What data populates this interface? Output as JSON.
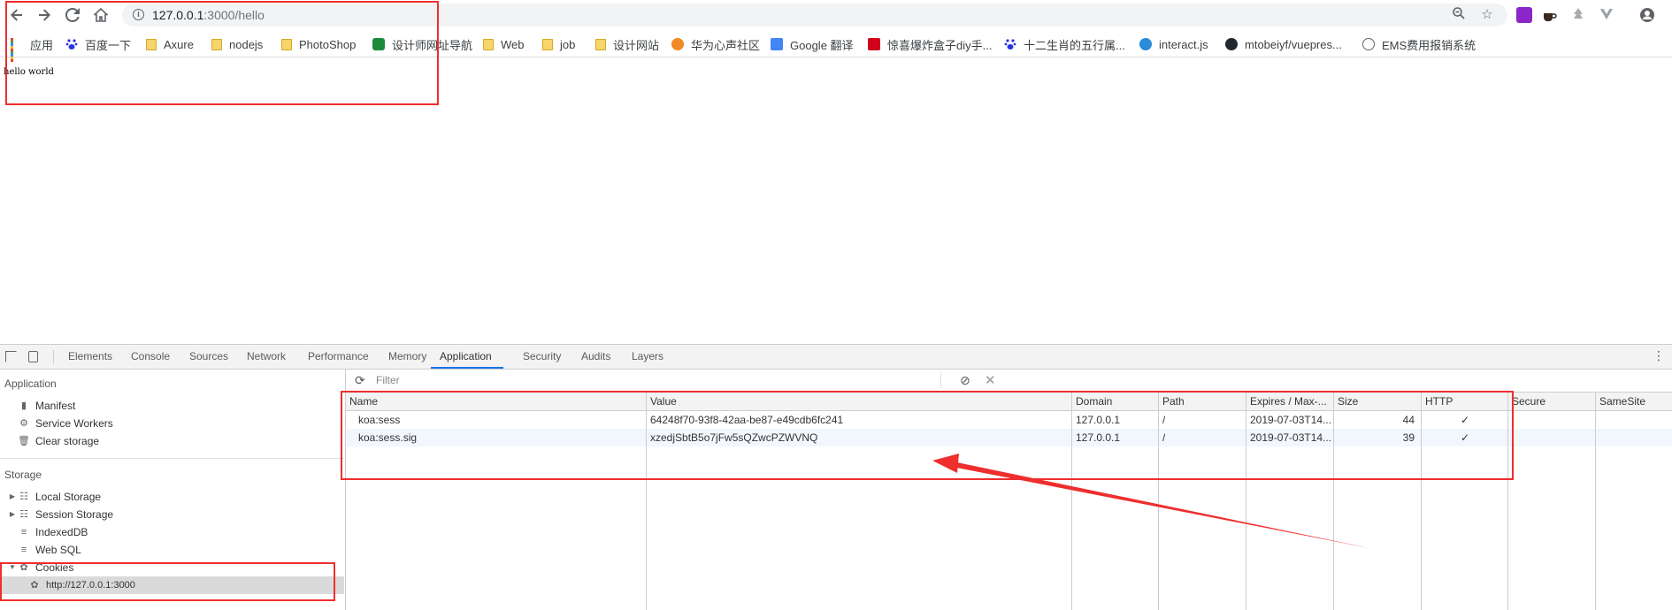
{
  "browser": {
    "url_host": "127.0.0.1",
    "url_path": ":3000/hello",
    "icons": [
      "back-icon",
      "forward-icon",
      "reload-icon",
      "home-icon",
      "info-icon",
      "zoom-icon",
      "star-icon",
      "profile-icon"
    ]
  },
  "bookmarks": [
    {
      "label": "应用",
      "icon": "apps-icon"
    },
    {
      "label": "百度一下",
      "icon": "baidu-icon"
    },
    {
      "label": "Axure",
      "icon": "folder-icon"
    },
    {
      "label": "nodejs",
      "icon": "folder-icon"
    },
    {
      "label": "PhotoShop",
      "icon": "folder-icon"
    },
    {
      "label": "设计师网址导航",
      "icon": "green-site-icon"
    },
    {
      "label": "Web",
      "icon": "folder-icon"
    },
    {
      "label": "job",
      "icon": "folder-icon"
    },
    {
      "label": "设计网站",
      "icon": "folder-icon"
    },
    {
      "label": "华为心声社区",
      "icon": "huawei-icon"
    },
    {
      "label": "Google 翻译",
      "icon": "translate-icon"
    },
    {
      "label": "惊喜爆炸盒子diy手...",
      "icon": "taobao-icon"
    },
    {
      "label": "十二生肖的五行属...",
      "icon": "baidu-icon"
    },
    {
      "label": "interact.js",
      "icon": "interact-icon"
    },
    {
      "label": "mtobeiyf/vuepres...",
      "icon": "github-icon"
    },
    {
      "label": "EMS费用报销系统",
      "icon": "globe-icon"
    }
  ],
  "page": {
    "body_text": "hello world"
  },
  "devtools": {
    "tabs": [
      "Elements",
      "Console",
      "Sources",
      "Network",
      "Performance",
      "Memory",
      "Application",
      "Security",
      "Audits",
      "Layers"
    ],
    "active_tab": "Application",
    "sidebar": {
      "application_header": "Application",
      "application_items": [
        "Manifest",
        "Service Workers",
        "Clear storage"
      ],
      "storage_header": "Storage",
      "storage_items": [
        "Local Storage",
        "Session Storage",
        "IndexedDB",
        "Web SQL",
        "Cookies"
      ],
      "cookie_origin": "http://127.0.0.1:3000"
    },
    "filter_placeholder": "Filter",
    "cookies_table": {
      "columns": [
        "Name",
        "Value",
        "Domain",
        "Path",
        "Expires / Max-...",
        "Size",
        "HTTP",
        "Secure",
        "SameSite"
      ],
      "rows": [
        {
          "name": "koa:sess",
          "value": "64248f70-93f8-42aa-be87-e49cdb6fc241",
          "domain": "127.0.0.1",
          "path": "/",
          "expires": "2019-07-03T14...",
          "size": "44",
          "http": "✓",
          "secure": "",
          "samesite": ""
        },
        {
          "name": "koa:sess.sig",
          "value": "xzedjSbtB5o7jFw5sQZwcPZWVNQ",
          "domain": "127.0.0.1",
          "path": "/",
          "expires": "2019-07-03T14...",
          "size": "39",
          "http": "✓",
          "secure": "",
          "samesite": ""
        }
      ]
    }
  },
  "colors": {
    "annotation_red": "#ef2e2e",
    "active_tab_accent": "#1a73e8"
  }
}
